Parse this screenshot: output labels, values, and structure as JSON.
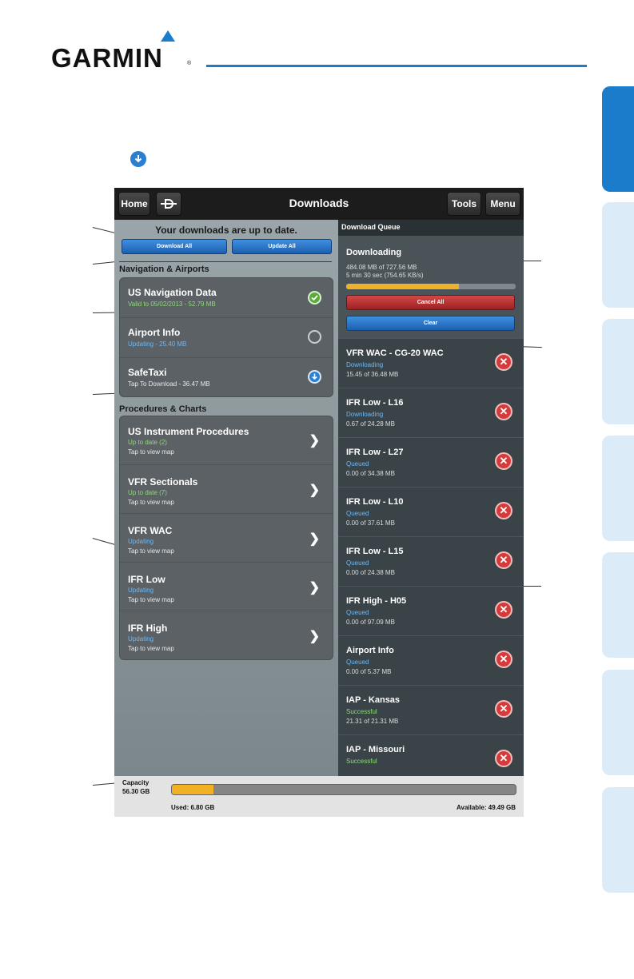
{
  "brand": {
    "logo_text": "GARMIN",
    "reg_mark": "®",
    "accent": "#1b7ccc"
  },
  "topbar": {
    "home": "Home",
    "title": "Downloads",
    "tools": "Tools",
    "menu": "Menu"
  },
  "left_panel": {
    "status_message": "Your downloads are up to date.",
    "download_all_label": "Download All",
    "update_all_label": "Update All",
    "nav_section_title": "Navigation & Airports",
    "nav_items": [
      {
        "title": "US Navigation Data",
        "subtitle": "Valid to 05/02/2013 - 52.79 MB",
        "status": "ok"
      },
      {
        "title": "Airport Info",
        "subtitle": "Updating - 25.40 MB",
        "status": "updating"
      },
      {
        "title": "SafeTaxi",
        "subtitle": "Tap To Download - 36.47 MB",
        "status": "download"
      }
    ],
    "proc_section_title": "Procedures & Charts",
    "proc_items": [
      {
        "title": "US Instrument Procedures",
        "status": "Up to date (2)",
        "hint": "Tap to view map"
      },
      {
        "title": "VFR Sectionals",
        "status": "Up to date (7)",
        "hint": "Tap to view map"
      },
      {
        "title": "VFR WAC",
        "status": "Updating",
        "hint": "Tap to view map"
      },
      {
        "title": "IFR Low",
        "status": "Updating",
        "hint": "Tap to view map"
      },
      {
        "title": "IFR High",
        "status": "Updating",
        "hint": "Tap to view map"
      }
    ]
  },
  "queue": {
    "header": "Download Queue",
    "active": {
      "title": "Downloading",
      "progress_text": "484.08 MB of 727.56 MB",
      "time_text": "5 min 30 sec (754.65 KB/s)",
      "progress_fraction": 0.665
    },
    "cancel_all_label": "Cancel All",
    "clear_label": "Clear",
    "items": [
      {
        "title": "VFR WAC - CG-20 WAC",
        "status": "Downloading",
        "size": "15.45 of 36.48 MB",
        "color": "blue"
      },
      {
        "title": "IFR Low - L16",
        "status": "Downloading",
        "size": "0.67 of 24.28 MB",
        "color": "blue"
      },
      {
        "title": "IFR Low - L27",
        "status": "Queued",
        "size": "0.00 of 34.38 MB",
        "color": "blue"
      },
      {
        "title": "IFR Low - L10",
        "status": "Queued",
        "size": "0.00 of 37.61 MB",
        "color": "blue"
      },
      {
        "title": "IFR Low - L15",
        "status": "Queued",
        "size": "0.00 of 24.38 MB",
        "color": "blue"
      },
      {
        "title": "IFR High - H05",
        "status": "Queued",
        "size": "0.00 of 97.09 MB",
        "color": "blue"
      },
      {
        "title": "Airport Info",
        "status": "Queued",
        "size": "0.00 of 5.37 MB",
        "color": "blue"
      },
      {
        "title": "IAP - Kansas",
        "status": "Successful",
        "size": "21.31 of 21.31 MB",
        "color": "green"
      },
      {
        "title": "IAP - Missouri",
        "status": "Successful",
        "size": "",
        "color": "green"
      }
    ]
  },
  "capacity": {
    "label": "Capacity",
    "total": "56.30 GB",
    "used_label": "Used:",
    "used": "6.80 GB",
    "available_label": "Available:",
    "available": "49.49 GB",
    "used_fraction": 0.121
  }
}
